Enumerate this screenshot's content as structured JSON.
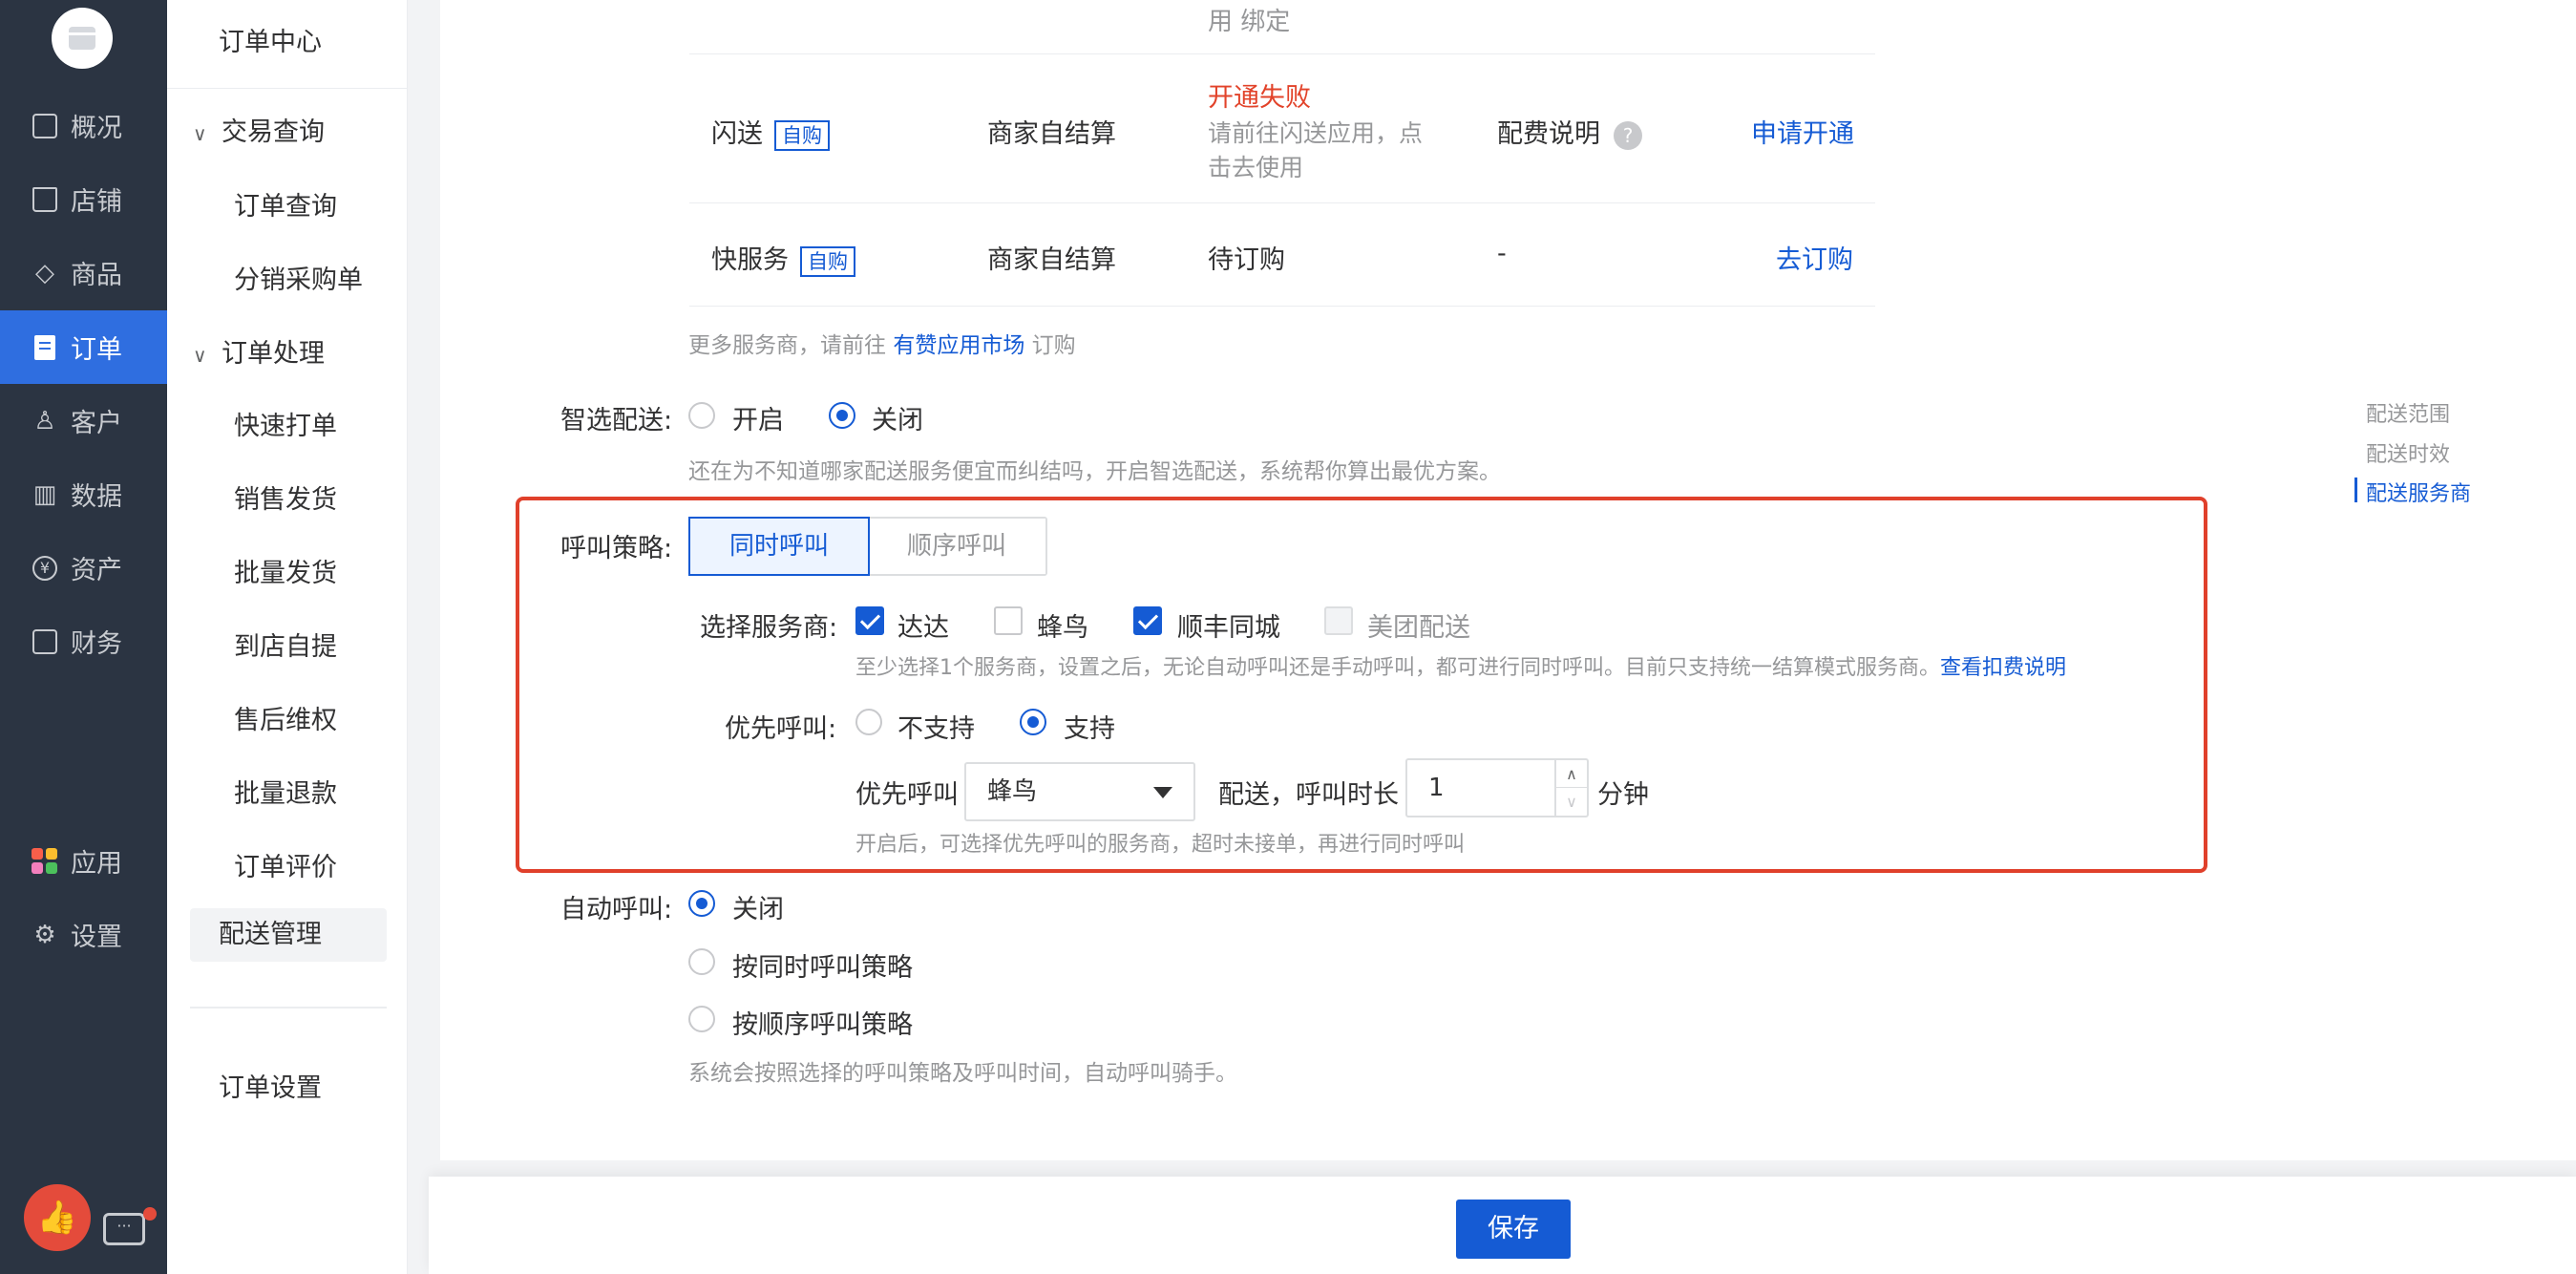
{
  "nav": {
    "items": [
      {
        "label": "概况",
        "icon": "monitor-icon"
      },
      {
        "label": "店铺",
        "icon": "store-icon"
      },
      {
        "label": "商品",
        "icon": "tag-icon"
      },
      {
        "label": "订单",
        "icon": "order-icon",
        "active": true
      },
      {
        "label": "客户",
        "icon": "user-icon"
      },
      {
        "label": "数据",
        "icon": "bar-chart-icon"
      },
      {
        "label": "资产",
        "icon": "yen-icon"
      },
      {
        "label": "财务",
        "icon": "finance-icon"
      },
      {
        "label": "应用",
        "icon": "apps-icon"
      },
      {
        "label": "设置",
        "icon": "gear-icon"
      }
    ],
    "brand_colors": {
      "background": "#2b3442",
      "active": "#2f6ee0"
    }
  },
  "subnav": {
    "title": "订单中心",
    "groups": [
      {
        "label": "交易查询",
        "items": [
          "订单查询",
          "分销采购单"
        ]
      },
      {
        "label": "订单处理",
        "items": [
          "快速打单",
          "销售发货",
          "批量发货",
          "到店自提",
          "售后维权",
          "批量退款",
          "订单评价",
          "配送管理"
        ]
      }
    ],
    "active_item": "配送管理",
    "footer_item": "订单设置"
  },
  "providers": {
    "top_fragment": "用 绑定",
    "rows": [
      {
        "name": "闪送",
        "tag": "自购",
        "settlement": "商家自结算",
        "status": "开通失败",
        "status_note_1": "请前往闪送应用，点",
        "status_note_2": "击去使用",
        "fee": "配费说明",
        "fee_help": "?",
        "action": "申请开通"
      },
      {
        "name": "快服务",
        "tag": "自购",
        "settlement": "商家自结算",
        "status": "待订购",
        "fee": "-",
        "action": "去订购"
      }
    ],
    "more_prefix": "更多服务商，请前往",
    "more_link": "有赞应用市场",
    "more_suffix": "订购"
  },
  "smart_delivery": {
    "label": "智选配送:",
    "options": [
      "开启",
      "关闭"
    ],
    "selected": "关闭",
    "hint": "还在为不知道哪家配送服务便宜而纠结吗，开启智选配送，系统帮你算出最优方案。"
  },
  "call_strategy": {
    "label": "呼叫策略:",
    "tabs": [
      "同时呼叫",
      "顺序呼叫"
    ],
    "selected": "同时呼叫",
    "provider_label": "选择服务商:",
    "providers": [
      {
        "name": "达达",
        "checked": true,
        "disabled": false
      },
      {
        "name": "蜂鸟",
        "checked": false,
        "disabled": false
      },
      {
        "name": "顺丰同城",
        "checked": true,
        "disabled": false
      },
      {
        "name": "美团配送",
        "checked": false,
        "disabled": true
      }
    ],
    "provider_hint": "至少选择1个服务商，设置之后，无论自动呼叫还是手动呼叫，都可进行同时呼叫。目前只支持统一结算模式服务商。",
    "provider_hint_link": "查看扣费说明",
    "priority_label": "优先呼叫:",
    "priority_options": [
      "不支持",
      "支持"
    ],
    "priority_selected": "支持",
    "priority_prefix": "优先呼叫",
    "priority_provider": "蜂鸟",
    "priority_mid": "配送，呼叫时长",
    "priority_duration": "1",
    "priority_unit": "分钟",
    "priority_hint": "开启后，可选择优先呼叫的服务商，超时未接单，再进行同时呼叫"
  },
  "auto_call": {
    "label": "自动呼叫:",
    "options": [
      "关闭",
      "按同时呼叫策略",
      "按顺序呼叫策略"
    ],
    "selected": "关闭",
    "hint": "系统会按照选择的呼叫策略及呼叫时间，自动呼叫骑手。"
  },
  "anchors": {
    "items": [
      "配送范围",
      "配送时效",
      "配送服务商"
    ],
    "active": "配送服务商"
  },
  "footer": {
    "save_label": "保存"
  },
  "colors": {
    "primary": "#155bd4",
    "danger": "#e2432a",
    "highlight_border": "#e0402b"
  }
}
